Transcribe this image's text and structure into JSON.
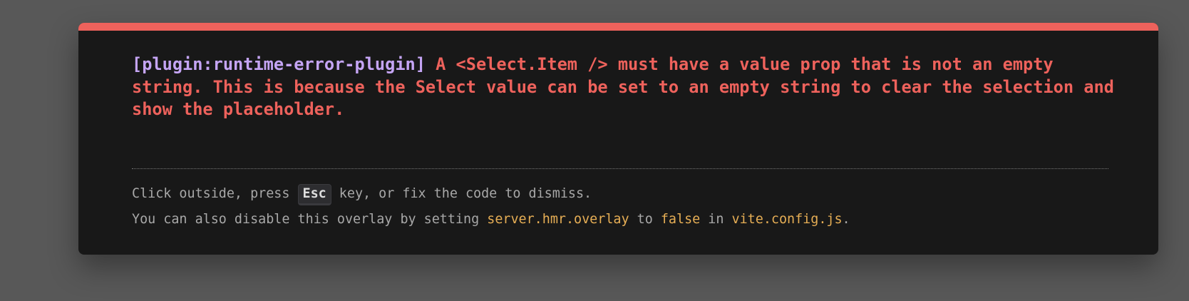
{
  "overlay": {
    "plugin": "[plugin:runtime-error-plugin]",
    "message": " A <Select.Item /> must have a value prop that is not an empty string. This is because the Select value can be set to an empty string to clear the selection and show the placeholder.",
    "tip1": {
      "before": "Click outside, press ",
      "key": "Esc",
      "after": " key, or fix the code to dismiss."
    },
    "tip2": {
      "before": "You can also disable this overlay by setting ",
      "setting": "server.hmr.overlay",
      "middle": " to ",
      "value": "false",
      "middle2": " in ",
      "file": "vite.config.js",
      "end": "."
    }
  },
  "colors": {
    "accent": "#ee625c",
    "plugin": "#c5a5f5",
    "code": "#e6ae55"
  }
}
